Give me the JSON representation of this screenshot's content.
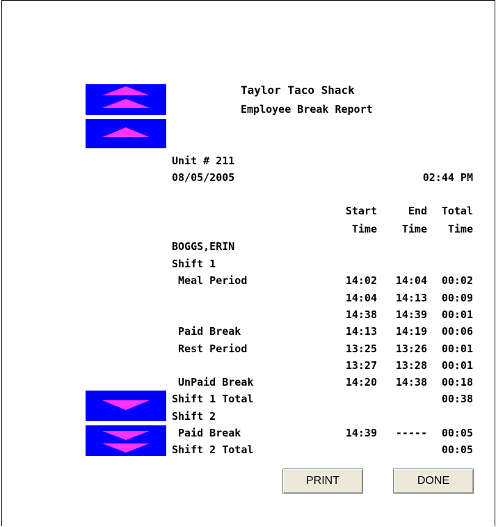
{
  "report": {
    "company": "Taylor Taco Shack",
    "title": "Employee Break Report",
    "unit": "Unit # 211",
    "date": "08/05/2005",
    "time": "02:44 PM",
    "columns": {
      "start1": "Start",
      "end1": "End",
      "total1": "Total",
      "start2": "Time",
      "end2": "Time",
      "total2": "Time"
    },
    "employee": "BOGGS,ERIN",
    "rows": [
      {
        "label": "Shift 1",
        "start": "",
        "end": "",
        "total": ""
      },
      {
        "label": " Meal Period",
        "start": "14:02",
        "end": "14:04",
        "total": "00:02"
      },
      {
        "label": "",
        "start": "14:04",
        "end": "14:13",
        "total": "00:09"
      },
      {
        "label": "",
        "start": "14:38",
        "end": "14:39",
        "total": "00:01"
      },
      {
        "label": " Paid Break",
        "start": "14:13",
        "end": "14:19",
        "total": "00:06"
      },
      {
        "label": " Rest Period",
        "start": "13:25",
        "end": "13:26",
        "total": "00:01"
      },
      {
        "label": "",
        "start": "13:27",
        "end": "13:28",
        "total": "00:01"
      },
      {
        "label": " UnPaid Break",
        "start": "14:20",
        "end": "14:38",
        "total": "00:18"
      },
      {
        "label": "Shift 1 Total",
        "start": "",
        "end": "",
        "total": "00:38"
      },
      {
        "label": "Shift 2",
        "start": "",
        "end": "",
        "total": ""
      },
      {
        "label": " Paid Break",
        "start": "14:39",
        "end": "-----",
        "total": "00:05"
      },
      {
        "label": "Shift 2 Total",
        "start": "",
        "end": "",
        "total": "00:05"
      }
    ]
  },
  "buttons": {
    "print": "PRINT",
    "done": "DONE"
  },
  "icons": {
    "page_up": "double-up-arrow-icon",
    "line_up": "up-arrow-icon",
    "line_down": "down-arrow-icon",
    "page_down": "double-down-arrow-icon"
  },
  "colors": {
    "scroll_bg": "#0000ff",
    "arrow": "#ff33ff"
  }
}
